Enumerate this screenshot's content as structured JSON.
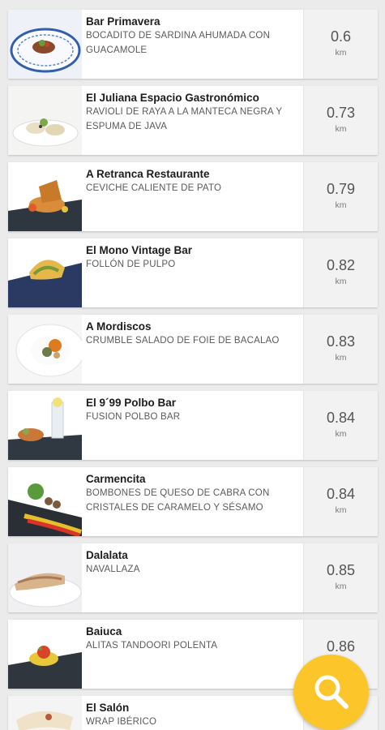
{
  "restaurants": [
    {
      "name": "Bar Primavera",
      "dish": "BOCADITO DE SARDINA AHUMADA CON GUACAMOLE",
      "distance": "0.6",
      "unit": "km"
    },
    {
      "name": "El Juliana Espacio Gastronómico",
      "dish": "RAVIOLI DE RAYA A LA MANTECA NEGRA Y ESPUMA DE JAVA",
      "distance": "0.73",
      "unit": "km"
    },
    {
      "name": "A Retranca Restaurante",
      "dish": "CEVICHE CALIENTE DE PATO",
      "distance": "0.79",
      "unit": "km"
    },
    {
      "name": "El Mono Vintage Bar",
      "dish": "FOLLÓN DE PULPO",
      "distance": "0.82",
      "unit": "km"
    },
    {
      "name": "A Mordiscos",
      "dish": "CRUMBLE SALADO DE FOIE DE BACALAO",
      "distance": "0.83",
      "unit": "km"
    },
    {
      "name": "El 9´99 Polbo Bar",
      "dish": "FUSION POLBO BAR",
      "distance": "0.84",
      "unit": "km"
    },
    {
      "name": "Carmencita",
      "dish": "BOMBONES DE QUESO DE CABRA CON CRISTALES DE CARAMELO Y SÉSAMO",
      "distance": "0.84",
      "unit": "km"
    },
    {
      "name": "Dalalata",
      "dish": "NAVALLAZA",
      "distance": "0.85",
      "unit": "km"
    },
    {
      "name": "Baiuca",
      "dish": "ALITAS TANDOORI POLENTA",
      "distance": "0.86",
      "unit": "km"
    },
    {
      "name": "El Salón",
      "dish": "WRAP IBÉRICO",
      "distance": "",
      "unit": ""
    }
  ],
  "fab": {
    "icon": "search-icon",
    "color": "#fcc62a"
  },
  "colors": {
    "background": "#ebebeb",
    "card": "#ffffff",
    "distance_panel": "#f2f2f2",
    "accent": "#fcc62a"
  }
}
